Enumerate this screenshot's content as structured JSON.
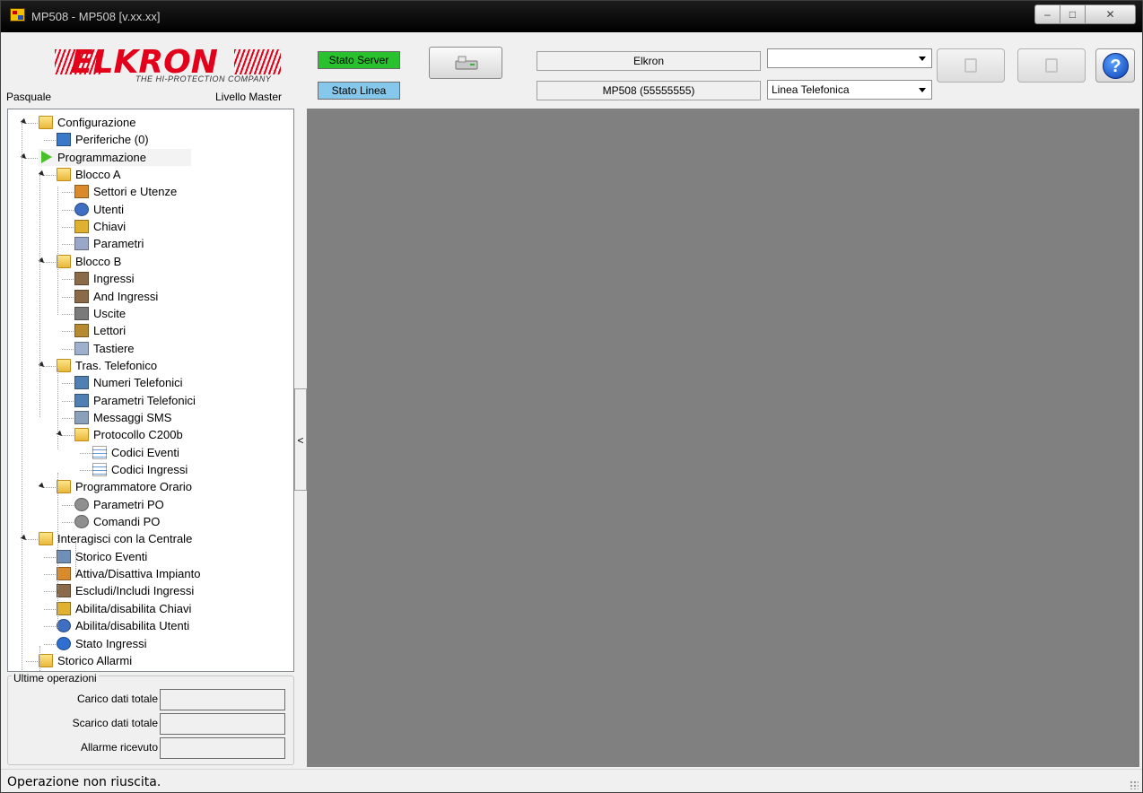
{
  "window": {
    "title": "MP508 - MP508 [v.xx.xx]",
    "controls": {
      "minimize": "–",
      "maximize": "□",
      "close": "✕"
    }
  },
  "header": {
    "logo_word": "ELKRON",
    "logo_tagline": "THE HI-PROTECTION COMPANY",
    "user_name": "Pasquale",
    "user_level": "Livello Master",
    "stato_server": "Stato Server",
    "stato_linea": "Stato Linea",
    "panel_name": "Elkron",
    "panel_model": "MP508 (55555555)",
    "combo_top_value": "",
    "combo_connection_value": "Linea Telefonica",
    "help_glyph": "?",
    "colors": {
      "server_ok": "#29c12d",
      "linea": "#86c8ec",
      "brand": "#e2001a"
    }
  },
  "tree": [
    {
      "label": "Configurazione",
      "icon": "folder-config-icon"
    },
    {
      "label": "Periferiche (0)",
      "icon": "network-icon"
    },
    {
      "label": "Programmazione",
      "icon": "green-arrow-icon"
    },
    {
      "label": "Blocco A",
      "icon": "folder-icon"
    },
    {
      "label": "Settori e Utenze",
      "icon": "house-icon"
    },
    {
      "label": "Utenti",
      "icon": "user-icon"
    },
    {
      "label": "Chiavi",
      "icon": "key-icon"
    },
    {
      "label": "Parametri",
      "icon": "hourglass-icon"
    },
    {
      "label": "Blocco B",
      "icon": "folder-icon"
    },
    {
      "label": "Ingressi",
      "icon": "door-icon"
    },
    {
      "label": "And Ingressi",
      "icon": "door-icon"
    },
    {
      "label": "Uscite",
      "icon": "speaker-icon"
    },
    {
      "label": "Lettori",
      "icon": "reader-icon"
    },
    {
      "label": "Tastiere",
      "icon": "keyboard-icon"
    },
    {
      "label": "Tras. Telefonico",
      "icon": "folder-icon"
    },
    {
      "label": "Numeri Telefonici",
      "icon": "phone-icon"
    },
    {
      "label": "Parametri Telefonici",
      "icon": "phone-settings-icon"
    },
    {
      "label": "Messaggi SMS",
      "icon": "mobile-icon"
    },
    {
      "label": "Protocollo C200b",
      "icon": "folder-icon"
    },
    {
      "label": "Codici Eventi",
      "icon": "table-icon"
    },
    {
      "label": "Codici Ingressi",
      "icon": "table-icon"
    },
    {
      "label": "Programmatore Orario",
      "icon": "folder-icon"
    },
    {
      "label": "Parametri PO",
      "icon": "clock-icon"
    },
    {
      "label": "Comandi PO",
      "icon": "clock-icon"
    },
    {
      "label": "Interagisci con la Centrale",
      "icon": "folder-arrow-icon"
    },
    {
      "label": "Storico Eventi",
      "icon": "history-icon"
    },
    {
      "label": "Attiva/Disattiva Impianto",
      "icon": "house-arm-icon"
    },
    {
      "label": "Escludi/Includi Ingressi",
      "icon": "door-toggle-icon"
    },
    {
      "label": "Abilita/disabilita Chiavi",
      "icon": "key-toggle-icon"
    },
    {
      "label": "Abilita/disabilita Utenti",
      "icon": "user-toggle-icon"
    },
    {
      "label": "Stato Ingressi",
      "icon": "info-icon"
    },
    {
      "label": "Storico Allarmi",
      "icon": "folder-alarm-icon"
    }
  ],
  "operations": {
    "title": "Ultime operazioni",
    "rows": [
      {
        "label": "Carico dati totale",
        "value": ""
      },
      {
        "label": "Scarico dati totale",
        "value": ""
      },
      {
        "label": "Allarme ricevuto",
        "value": ""
      }
    ]
  },
  "splitter_glyph": "<",
  "status": {
    "text": "Operazione non riuscita."
  }
}
